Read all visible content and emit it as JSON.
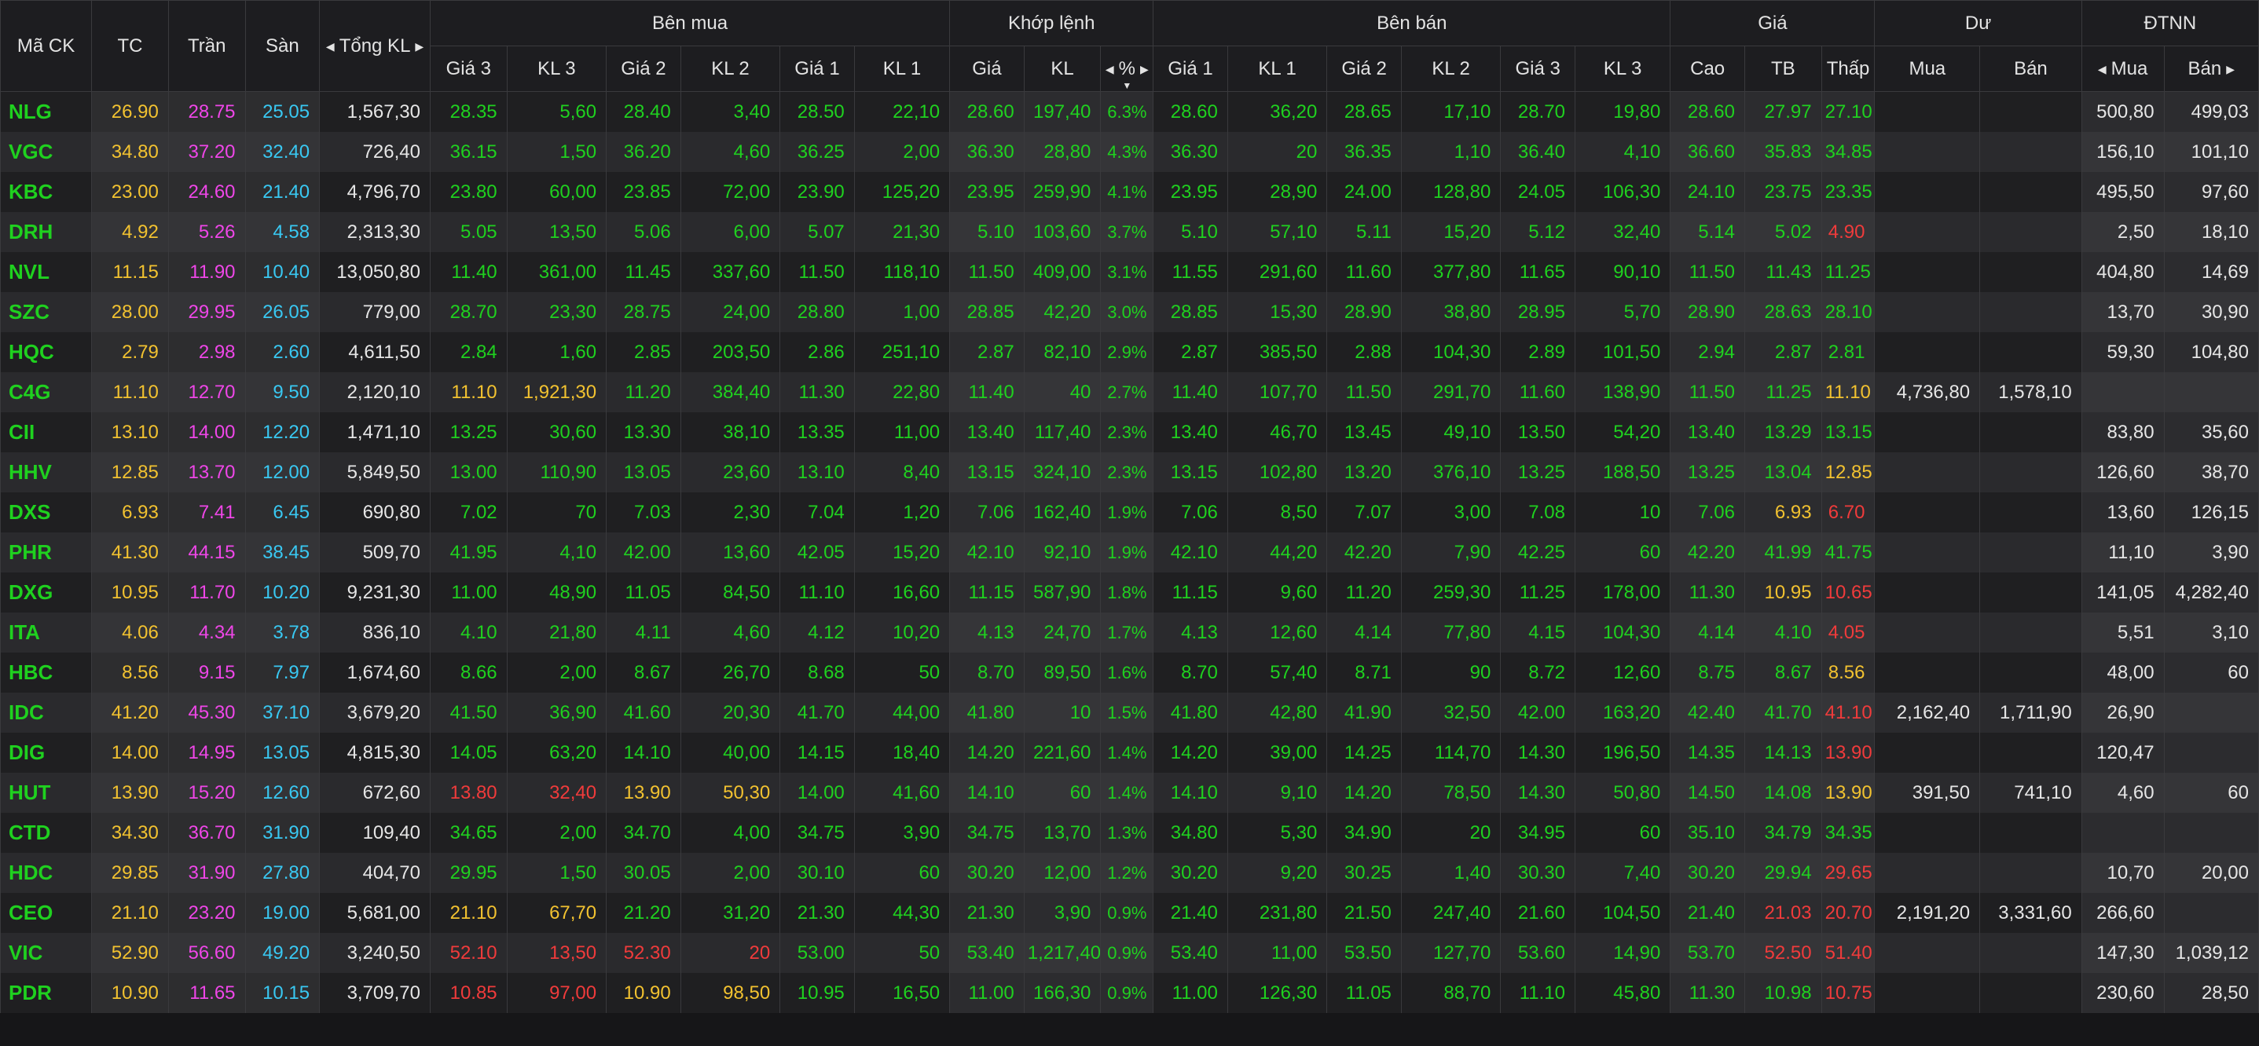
{
  "header": {
    "row1": [
      {
        "key": "sym",
        "label": "Mã CK"
      },
      {
        "key": "tc",
        "label": "TC"
      },
      {
        "key": "tran",
        "label": "Trần"
      },
      {
        "key": "san",
        "label": "Sàn"
      },
      {
        "key": "tongkl",
        "label": "Tổng KL"
      },
      {
        "key": "benmua",
        "label": "Bên mua"
      },
      {
        "key": "khop",
        "label": "Khớp lệnh"
      },
      {
        "key": "benban",
        "label": "Bên bán"
      },
      {
        "key": "gia",
        "label": "Giá"
      },
      {
        "key": "du",
        "label": "Dư"
      },
      {
        "key": "dtnn",
        "label": "ĐTNN"
      }
    ],
    "row2": [
      "Giá 3",
      "KL 3",
      "Giá 2",
      "KL 2",
      "Giá 1",
      "KL 1",
      "Giá",
      "KL",
      "%",
      "Giá 1",
      "KL 1",
      "Giá 2",
      "KL 2",
      "Giá 3",
      "KL 3",
      "Cao",
      "TB",
      "Thấp",
      "Mua",
      "Bán",
      "Mua",
      "Bán"
    ]
  },
  "colors": {
    "up": "#1fd11f",
    "ref": "#f2c230",
    "down": "#f03b3b",
    "ceil": "#ef46e8",
    "floor": "#39c8f2"
  },
  "icons": {
    "scroll_left": "caret-left-icon",
    "scroll_right": "caret-right-icon",
    "sort": "sort-desc-icon"
  },
  "rows": [
    {
      "s": "NLG",
      "tc": "26.90",
      "tr": "28.75",
      "sa": "25.05",
      "tkl": "1,567,30",
      "bg3": "28.35",
      "bk3": "5,60",
      "bg2": "28.40",
      "bk2": "3,40",
      "bg1": "28.50",
      "bk1": "22,10",
      "kg": "28.60",
      "kk": "197,40",
      "pct": "6.3%",
      "sg1": "28.60",
      "sk1": "36,20",
      "sg2": "28.65",
      "sk2": "17,10",
      "sg3": "28.70",
      "sk3": "19,80",
      "cao": "28.60",
      "tb": "27.97",
      "thap": "27.10",
      "dm": "",
      "db": "",
      "nm": "500,80",
      "nb": "499,03"
    },
    {
      "s": "VGC",
      "tc": "34.80",
      "tr": "37.20",
      "sa": "32.40",
      "tkl": "726,40",
      "bg3": "36.15",
      "bk3": "1,50",
      "bg2": "36.20",
      "bk2": "4,60",
      "bg1": "36.25",
      "bk1": "2,00",
      "kg": "36.30",
      "kk": "28,80",
      "pct": "4.3%",
      "sg1": "36.30",
      "sk1": "20",
      "sg2": "36.35",
      "sk2": "1,10",
      "sg3": "36.40",
      "sk3": "4,10",
      "cao": "36.60",
      "tb": "35.83",
      "thap": "34.85",
      "dm": "",
      "db": "",
      "nm": "156,10",
      "nb": "101,10"
    },
    {
      "s": "KBC",
      "tc": "23.00",
      "tr": "24.60",
      "sa": "21.40",
      "tkl": "4,796,70",
      "bg3": "23.80",
      "bk3": "60,00",
      "bg2": "23.85",
      "bk2": "72,00",
      "bg1": "23.90",
      "bk1": "125,20",
      "kg": "23.95",
      "kk": "259,90",
      "pct": "4.1%",
      "sg1": "23.95",
      "sk1": "28,90",
      "sg2": "24.00",
      "sk2": "128,80",
      "sg3": "24.05",
      "sk3": "106,30",
      "cao": "24.10",
      "tb": "23.75",
      "thap": "23.35",
      "dm": "",
      "db": "",
      "nm": "495,50",
      "nb": "97,60"
    },
    {
      "s": "DRH",
      "tc": "4.92",
      "tr": "5.26",
      "sa": "4.58",
      "tkl": "2,313,30",
      "bg3": "5.05",
      "bk3": "13,50",
      "bg2": "5.06",
      "bk2": "6,00",
      "bg1": "5.07",
      "bk1": "21,30",
      "kg": "5.10",
      "kk": "103,60",
      "pct": "3.7%",
      "sg1": "5.10",
      "sk1": "57,10",
      "sg2": "5.11",
      "sk2": "15,20",
      "sg3": "5.12",
      "sk3": "32,40",
      "cao": "5.14",
      "tb": "5.02",
      "thap": "4.90",
      "dm": "",
      "db": "",
      "nm": "2,50",
      "nb": "18,10"
    },
    {
      "s": "NVL",
      "tc": "11.15",
      "tr": "11.90",
      "sa": "10.40",
      "tkl": "13,050,80",
      "bg3": "11.40",
      "bk3": "361,00",
      "bg2": "11.45",
      "bk2": "337,60",
      "bg1": "11.50",
      "bk1": "118,10",
      "kg": "11.50",
      "kk": "409,00",
      "pct": "3.1%",
      "sg1": "11.55",
      "sk1": "291,60",
      "sg2": "11.60",
      "sk2": "377,80",
      "sg3": "11.65",
      "sk3": "90,10",
      "cao": "11.50",
      "tb": "11.43",
      "thap": "11.25",
      "dm": "",
      "db": "",
      "nm": "404,80",
      "nb": "14,69"
    },
    {
      "s": "SZC",
      "tc": "28.00",
      "tr": "29.95",
      "sa": "26.05",
      "tkl": "779,00",
      "bg3": "28.70",
      "bk3": "23,30",
      "bg2": "28.75",
      "bk2": "24,00",
      "bg1": "28.80",
      "bk1": "1,00",
      "kg": "28.85",
      "kk": "42,20",
      "pct": "3.0%",
      "sg1": "28.85",
      "sk1": "15,30",
      "sg2": "28.90",
      "sk2": "38,80",
      "sg3": "28.95",
      "sk3": "5,70",
      "cao": "28.90",
      "tb": "28.63",
      "thap": "28.10",
      "dm": "",
      "db": "",
      "nm": "13,70",
      "nb": "30,90"
    },
    {
      "s": "HQC",
      "tc": "2.79",
      "tr": "2.98",
      "sa": "2.60",
      "tkl": "4,611,50",
      "bg3": "2.84",
      "bk3": "1,60",
      "bg2": "2.85",
      "bk2": "203,50",
      "bg1": "2.86",
      "bk1": "251,10",
      "kg": "2.87",
      "kk": "82,10",
      "pct": "2.9%",
      "sg1": "2.87",
      "sk1": "385,50",
      "sg2": "2.88",
      "sk2": "104,30",
      "sg3": "2.89",
      "sk3": "101,50",
      "cao": "2.94",
      "tb": "2.87",
      "thap": "2.81",
      "dm": "",
      "db": "",
      "nm": "59,30",
      "nb": "104,80"
    },
    {
      "s": "C4G",
      "tc": "11.10",
      "tr": "12.70",
      "sa": "9.50",
      "tkl": "2,120,10",
      "bg3": "11.10",
      "bk3": "1,921,30",
      "bg2": "11.20",
      "bk2": "384,40",
      "bg1": "11.30",
      "bk1": "22,80",
      "kg": "11.40",
      "kk": "40",
      "pct": "2.7%",
      "sg1": "11.40",
      "sk1": "107,70",
      "sg2": "11.50",
      "sk2": "291,70",
      "sg3": "11.60",
      "sk3": "138,90",
      "cao": "11.50",
      "tb": "11.25",
      "thap": "11.10",
      "dm": "4,736,80",
      "db": "1,578,10",
      "nm": "",
      "nb": ""
    },
    {
      "s": "CII",
      "tc": "13.10",
      "tr": "14.00",
      "sa": "12.20",
      "tkl": "1,471,10",
      "bg3": "13.25",
      "bk3": "30,60",
      "bg2": "13.30",
      "bk2": "38,10",
      "bg1": "13.35",
      "bk1": "11,00",
      "kg": "13.40",
      "kk": "117,40",
      "pct": "2.3%",
      "sg1": "13.40",
      "sk1": "46,70",
      "sg2": "13.45",
      "sk2": "49,10",
      "sg3": "13.50",
      "sk3": "54,20",
      "cao": "13.40",
      "tb": "13.29",
      "thap": "13.15",
      "dm": "",
      "db": "",
      "nm": "83,80",
      "nb": "35,60"
    },
    {
      "s": "HHV",
      "tc": "12.85",
      "tr": "13.70",
      "sa": "12.00",
      "tkl": "5,849,50",
      "bg3": "13.00",
      "bk3": "110,90",
      "bg2": "13.05",
      "bk2": "23,60",
      "bg1": "13.10",
      "bk1": "8,40",
      "kg": "13.15",
      "kk": "324,10",
      "pct": "2.3%",
      "sg1": "13.15",
      "sk1": "102,80",
      "sg2": "13.20",
      "sk2": "376,10",
      "sg3": "13.25",
      "sk3": "188,50",
      "cao": "13.25",
      "tb": "13.04",
      "thap": "12.85",
      "dm": "",
      "db": "",
      "nm": "126,60",
      "nb": "38,70"
    },
    {
      "s": "DXS",
      "tc": "6.93",
      "tr": "7.41",
      "sa": "6.45",
      "tkl": "690,80",
      "bg3": "7.02",
      "bk3": "70",
      "bg2": "7.03",
      "bk2": "2,30",
      "bg1": "7.04",
      "bk1": "1,20",
      "kg": "7.06",
      "kk": "162,40",
      "pct": "1.9%",
      "sg1": "7.06",
      "sk1": "8,50",
      "sg2": "7.07",
      "sk2": "3,00",
      "sg3": "7.08",
      "sk3": "10",
      "cao": "7.06",
      "tb": "6.93",
      "thap": "6.70",
      "dm": "",
      "db": "",
      "nm": "13,60",
      "nb": "126,15"
    },
    {
      "s": "PHR",
      "tc": "41.30",
      "tr": "44.15",
      "sa": "38.45",
      "tkl": "509,70",
      "bg3": "41.95",
      "bk3": "4,10",
      "bg2": "42.00",
      "bk2": "13,60",
      "bg1": "42.05",
      "bk1": "15,20",
      "kg": "42.10",
      "kk": "92,10",
      "pct": "1.9%",
      "sg1": "42.10",
      "sk1": "44,20",
      "sg2": "42.20",
      "sk2": "7,90",
      "sg3": "42.25",
      "sk3": "60",
      "cao": "42.20",
      "tb": "41.99",
      "thap": "41.75",
      "dm": "",
      "db": "",
      "nm": "11,10",
      "nb": "3,90"
    },
    {
      "s": "DXG",
      "tc": "10.95",
      "tr": "11.70",
      "sa": "10.20",
      "tkl": "9,231,30",
      "bg3": "11.00",
      "bk3": "48,90",
      "bg2": "11.05",
      "bk2": "84,50",
      "bg1": "11.10",
      "bk1": "16,60",
      "kg": "11.15",
      "kk": "587,90",
      "pct": "1.8%",
      "sg1": "11.15",
      "sk1": "9,60",
      "sg2": "11.20",
      "sk2": "259,30",
      "sg3": "11.25",
      "sk3": "178,00",
      "cao": "11.30",
      "tb": "10.95",
      "thap": "10.65",
      "dm": "",
      "db": "",
      "nm": "141,05",
      "nb": "4,282,40"
    },
    {
      "s": "ITA",
      "tc": "4.06",
      "tr": "4.34",
      "sa": "3.78",
      "tkl": "836,10",
      "bg3": "4.10",
      "bk3": "21,80",
      "bg2": "4.11",
      "bk2": "4,60",
      "bg1": "4.12",
      "bk1": "10,20",
      "kg": "4.13",
      "kk": "24,70",
      "pct": "1.7%",
      "sg1": "4.13",
      "sk1": "12,60",
      "sg2": "4.14",
      "sk2": "77,80",
      "sg3": "4.15",
      "sk3": "104,30",
      "cao": "4.14",
      "tb": "4.10",
      "thap": "4.05",
      "dm": "",
      "db": "",
      "nm": "5,51",
      "nb": "3,10"
    },
    {
      "s": "HBC",
      "tc": "8.56",
      "tr": "9.15",
      "sa": "7.97",
      "tkl": "1,674,60",
      "bg3": "8.66",
      "bk3": "2,00",
      "bg2": "8.67",
      "bk2": "26,70",
      "bg1": "8.68",
      "bk1": "50",
      "kg": "8.70",
      "kk": "89,50",
      "pct": "1.6%",
      "sg1": "8.70",
      "sk1": "57,40",
      "sg2": "8.71",
      "sk2": "90",
      "sg3": "8.72",
      "sk3": "12,60",
      "cao": "8.75",
      "tb": "8.67",
      "thap": "8.56",
      "dm": "",
      "db": "",
      "nm": "48,00",
      "nb": "60"
    },
    {
      "s": "IDC",
      "tc": "41.20",
      "tr": "45.30",
      "sa": "37.10",
      "tkl": "3,679,20",
      "bg3": "41.50",
      "bk3": "36,90",
      "bg2": "41.60",
      "bk2": "20,30",
      "bg1": "41.70",
      "bk1": "44,00",
      "kg": "41.80",
      "kk": "10",
      "pct": "1.5%",
      "sg1": "41.80",
      "sk1": "42,80",
      "sg2": "41.90",
      "sk2": "32,50",
      "sg3": "42.00",
      "sk3": "163,20",
      "cao": "42.40",
      "tb": "41.70",
      "thap": "41.10",
      "dm": "2,162,40",
      "db": "1,711,90",
      "nm": "26,90",
      "nb": ""
    },
    {
      "s": "DIG",
      "tc": "14.00",
      "tr": "14.95",
      "sa": "13.05",
      "tkl": "4,815,30",
      "bg3": "14.05",
      "bk3": "63,20",
      "bg2": "14.10",
      "bk2": "40,00",
      "bg1": "14.15",
      "bk1": "18,40",
      "kg": "14.20",
      "kk": "221,60",
      "pct": "1.4%",
      "sg1": "14.20",
      "sk1": "39,00",
      "sg2": "14.25",
      "sk2": "114,70",
      "sg3": "14.30",
      "sk3": "196,50",
      "cao": "14.35",
      "tb": "14.13",
      "thap": "13.90",
      "dm": "",
      "db": "",
      "nm": "120,47",
      "nb": ""
    },
    {
      "s": "HUT",
      "tc": "13.90",
      "tr": "15.20",
      "sa": "12.60",
      "tkl": "672,60",
      "bg3": "13.80",
      "bk3": "32,40",
      "bg2": "13.90",
      "bk2": "50,30",
      "bg1": "14.00",
      "bk1": "41,60",
      "kg": "14.10",
      "kk": "60",
      "pct": "1.4%",
      "sg1": "14.10",
      "sk1": "9,10",
      "sg2": "14.20",
      "sk2": "78,50",
      "sg3": "14.30",
      "sk3": "50,80",
      "cao": "14.50",
      "tb": "14.08",
      "thap": "13.90",
      "dm": "391,50",
      "db": "741,10",
      "nm": "4,60",
      "nb": "60"
    },
    {
      "s": "CTD",
      "tc": "34.30",
      "tr": "36.70",
      "sa": "31.90",
      "tkl": "109,40",
      "bg3": "34.65",
      "bk3": "2,00",
      "bg2": "34.70",
      "bk2": "4,00",
      "bg1": "34.75",
      "bk1": "3,90",
      "kg": "34.75",
      "kk": "13,70",
      "pct": "1.3%",
      "sg1": "34.80",
      "sk1": "5,30",
      "sg2": "34.90",
      "sk2": "20",
      "sg3": "34.95",
      "sk3": "60",
      "cao": "35.10",
      "tb": "34.79",
      "thap": "34.35",
      "dm": "",
      "db": "",
      "nm": "",
      "nb": ""
    },
    {
      "s": "HDC",
      "tc": "29.85",
      "tr": "31.90",
      "sa": "27.80",
      "tkl": "404,70",
      "bg3": "29.95",
      "bk3": "1,50",
      "bg2": "30.05",
      "bk2": "2,00",
      "bg1": "30.10",
      "bk1": "60",
      "kg": "30.20",
      "kk": "12,00",
      "pct": "1.2%",
      "sg1": "30.20",
      "sk1": "9,20",
      "sg2": "30.25",
      "sk2": "1,40",
      "sg3": "30.30",
      "sk3": "7,40",
      "cao": "30.20",
      "tb": "29.94",
      "thap": "29.65",
      "dm": "",
      "db": "",
      "nm": "10,70",
      "nb": "20,00"
    },
    {
      "s": "CEO",
      "tc": "21.10",
      "tr": "23.20",
      "sa": "19.00",
      "tkl": "5,681,00",
      "bg3": "21.10",
      "bk3": "67,70",
      "bg2": "21.20",
      "bk2": "31,20",
      "bg1": "21.30",
      "bk1": "44,30",
      "kg": "21.30",
      "kk": "3,90",
      "pct": "0.9%",
      "sg1": "21.40",
      "sk1": "231,80",
      "sg2": "21.50",
      "sk2": "247,40",
      "sg3": "21.60",
      "sk3": "104,50",
      "cao": "21.40",
      "tb": "21.03",
      "thap": "20.70",
      "dm": "2,191,20",
      "db": "3,331,60",
      "nm": "266,60",
      "nb": ""
    },
    {
      "s": "VIC",
      "tc": "52.90",
      "tr": "56.60",
      "sa": "49.20",
      "tkl": "3,240,50",
      "bg3": "52.10",
      "bk3": "13,50",
      "bg2": "52.30",
      "bk2": "20",
      "bg1": "53.00",
      "bk1": "50",
      "kg": "53.40",
      "kk": "1,217,40",
      "pct": "0.9%",
      "sg1": "53.40",
      "sk1": "11,00",
      "sg2": "53.50",
      "sk2": "127,70",
      "sg3": "53.60",
      "sk3": "14,90",
      "cao": "53.70",
      "tb": "52.50",
      "thap": "51.40",
      "dm": "",
      "db": "",
      "nm": "147,30",
      "nb": "1,039,12"
    },
    {
      "s": "PDR",
      "tc": "10.90",
      "tr": "11.65",
      "sa": "10.15",
      "tkl": "3,709,70",
      "bg3": "10.85",
      "bk3": "97,00",
      "bg2": "10.90",
      "bk2": "98,50",
      "bg1": "10.95",
      "bk1": "16,50",
      "kg": "11.00",
      "kk": "166,30",
      "pct": "0.9%",
      "sg1": "11.00",
      "sk1": "126,30",
      "sg2": "11.05",
      "sk2": "88,70",
      "sg3": "11.10",
      "sk3": "45,80",
      "cao": "11.30",
      "tb": "10.98",
      "thap": "10.75",
      "dm": "",
      "db": "",
      "nm": "230,60",
      "nb": "28,50"
    }
  ]
}
